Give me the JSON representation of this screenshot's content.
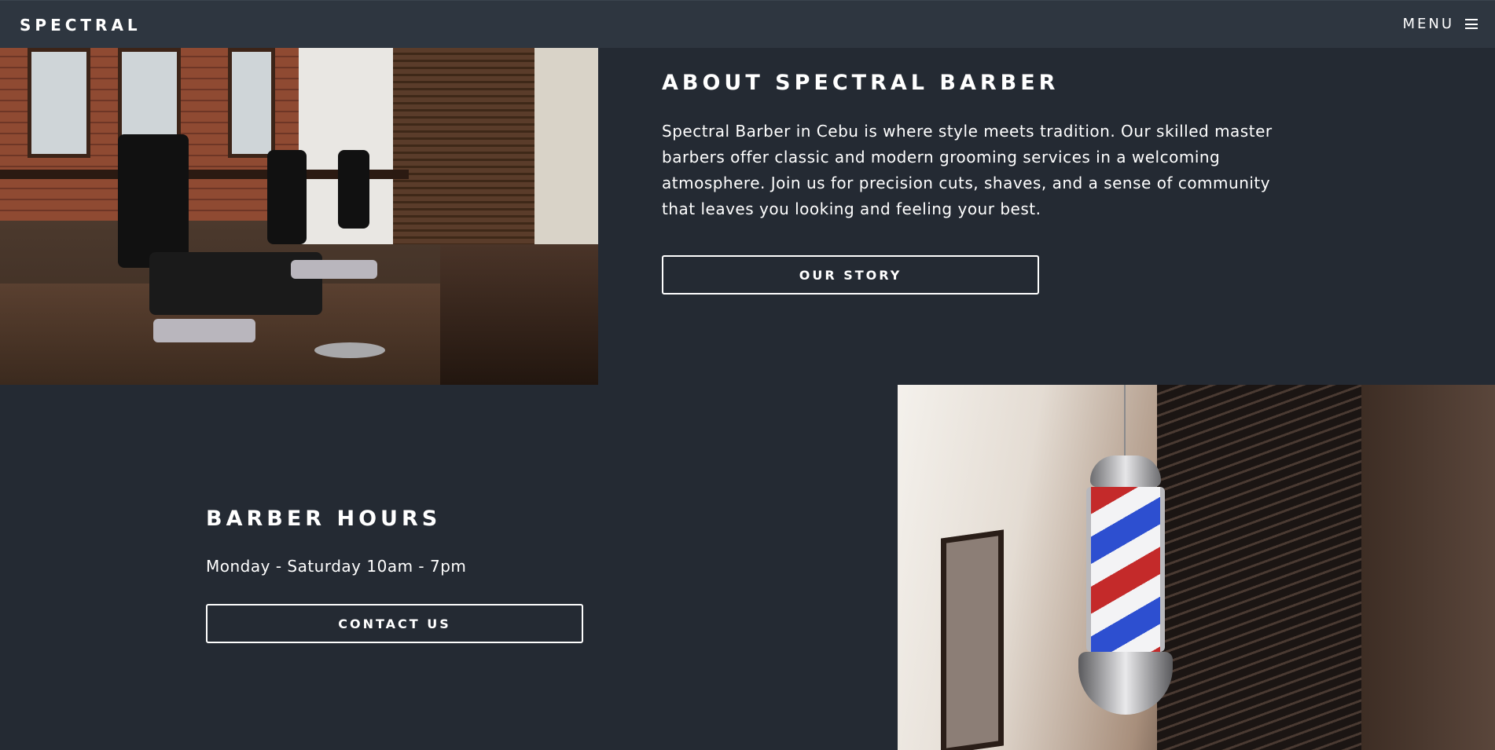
{
  "header": {
    "logo": "SPECTRAL",
    "menu_label": "MENU",
    "menu_icon": "hamburger-icon"
  },
  "about": {
    "title": "ABOUT SPECTRAL BARBER",
    "text": "Spectral Barber in Cebu is where style meets tradition. Our skilled master barbers offer classic and modern grooming services in a welcoming atmosphere. Join us for precision cuts, shaves, and a sense of community that leaves you looking and feeling your best.",
    "button": "OUR STORY"
  },
  "hours": {
    "title": "BARBER HOURS",
    "text": "Monday - Saturday 10am - 7pm",
    "button": "CONTACT US"
  },
  "colors": {
    "background": "#242a33",
    "header": "#2e3640",
    "text": "#ffffff"
  }
}
